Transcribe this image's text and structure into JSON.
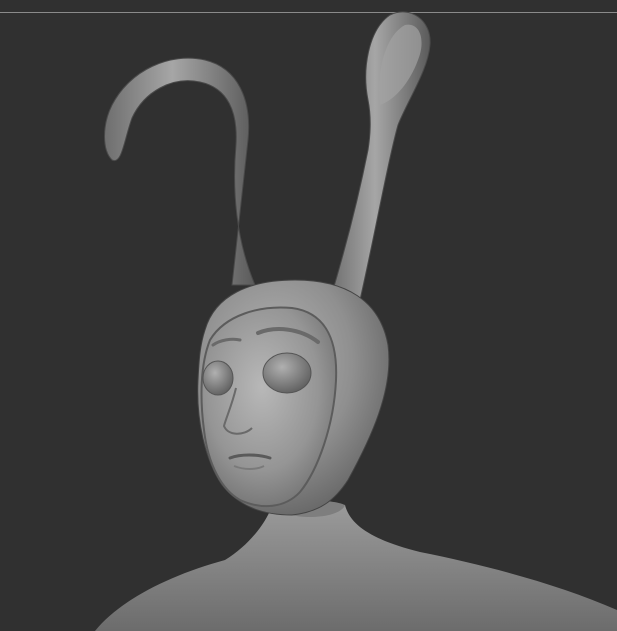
{
  "viewport": {
    "background_color": "#303030",
    "model_color": "#8c8c8c",
    "edge_line_color": "#8a8a8a"
  },
  "model": {
    "icon": "sculpt-model-icon"
  }
}
